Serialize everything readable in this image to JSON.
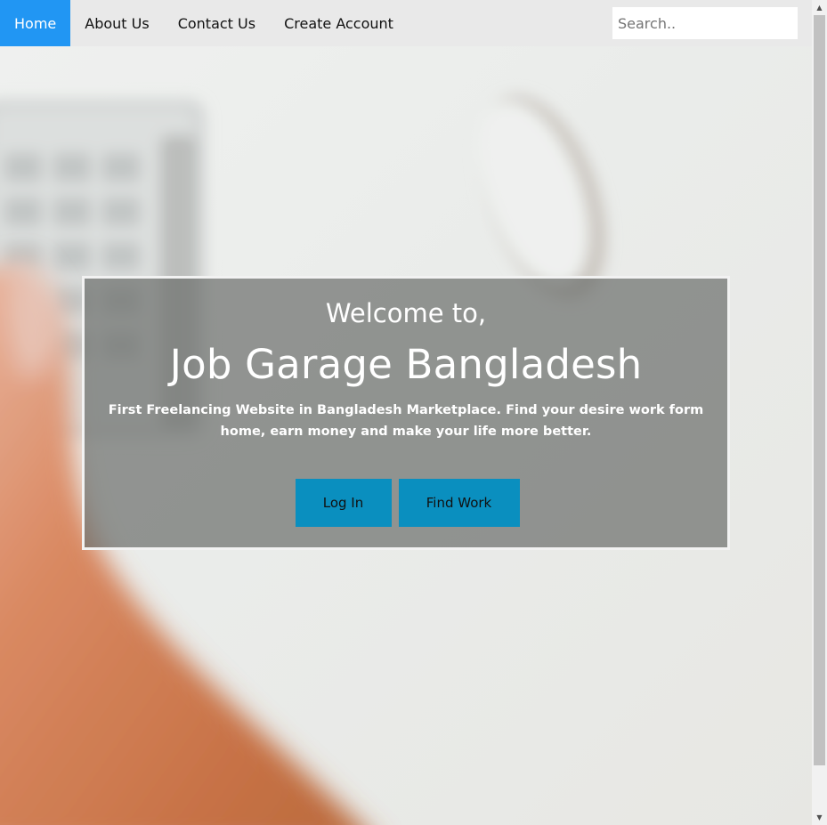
{
  "nav": {
    "items": [
      {
        "label": "Home",
        "active": true
      },
      {
        "label": "About Us",
        "active": false
      },
      {
        "label": "Contact Us",
        "active": false
      },
      {
        "label": "Create Account",
        "active": false
      }
    ],
    "search_placeholder": "Search.."
  },
  "hero": {
    "welcome": "Welcome to,",
    "title": "Job Garage Bangladesh",
    "description": "First Freelancing Website in Bangladesh Marketplace. Find your desire work form home, earn money and make your life more better.",
    "login_label": "Log In",
    "find_work_label": "Find Work"
  },
  "colors": {
    "nav_active": "#2196f3",
    "nav_bg": "#e9e9e9",
    "button": "#0a8fbf",
    "hero_overlay": "#6e706e"
  },
  "icons": {
    "scroll_up": "scroll-up-arrow-icon",
    "scroll_down": "scroll-down-arrow-icon"
  }
}
